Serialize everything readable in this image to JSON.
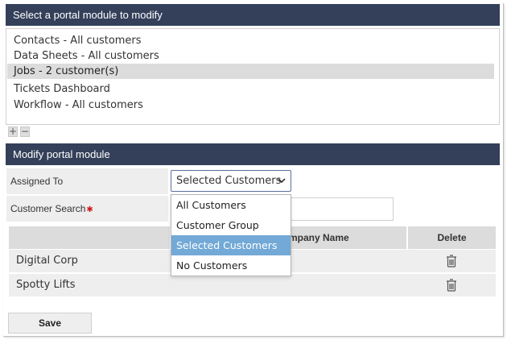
{
  "module_list": {
    "header": "Select a portal module to modify",
    "items": [
      {
        "label": "Contacts - All customers",
        "selected": false
      },
      {
        "label": "Data Sheets - All customers",
        "selected": false
      },
      {
        "label": "Jobs - 2 customer(s)",
        "selected": true
      },
      {
        "label": "Tickets Dashboard",
        "selected": false
      },
      {
        "label": "Workflow - All customers",
        "selected": false
      }
    ],
    "add_label": "+",
    "remove_label": "−"
  },
  "modify": {
    "header": "Modify portal module",
    "assigned_to_label": "Assigned To",
    "assigned_to_value": "Selected Customers",
    "assigned_to_options": [
      "All Customers",
      "Customer Group",
      "Selected Customers",
      "No Customers"
    ],
    "customer_search_label": "Customer Search",
    "required_mark": "✱",
    "chevron": "⌵"
  },
  "table": {
    "columns": [
      "",
      "Company Name",
      "Delete"
    ],
    "rows": [
      {
        "name": "Digital Corp"
      },
      {
        "name": "Spotty Lifts"
      }
    ]
  },
  "save_label": "Save",
  "colors": {
    "header_bg": "#34405a",
    "active_option": "#72a9d6",
    "required": "#d01818"
  }
}
